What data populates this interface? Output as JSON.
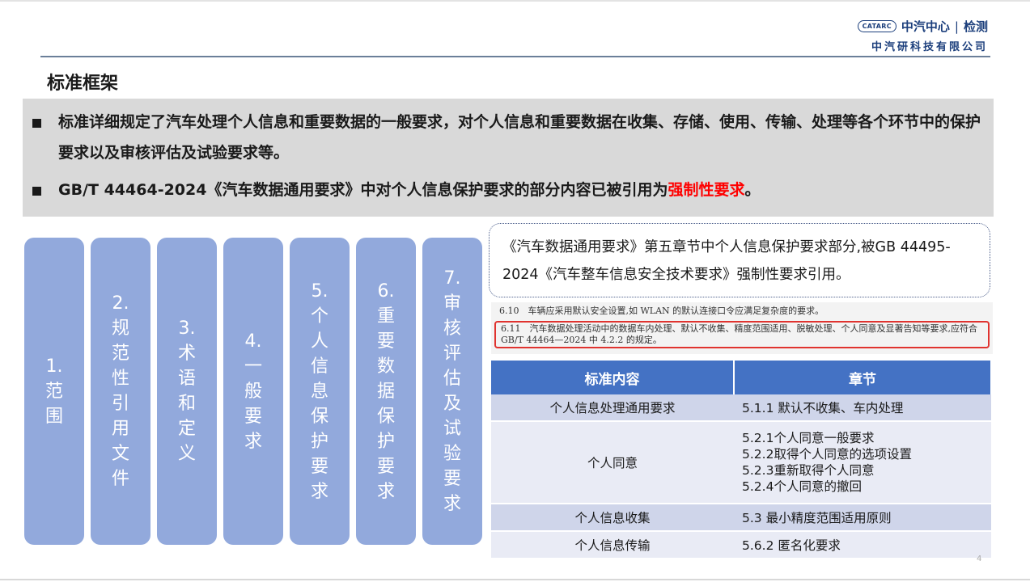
{
  "logo": {
    "mark": "CATARC",
    "brand": "中汽中心",
    "unit": "检测",
    "company": "中汽研科技有限公司"
  },
  "section_title": "标准框架",
  "intro": {
    "bullet1": "标准详细规定了汽车处理个人信息和重要数据的一般要求，对个人信息和重要数据在收集、存储、使用、传输、处理等各个环节中的保护要求以及审核评估及试验要求等。",
    "bullet2_prefix": "GB/T 44464-2024《汽车数据通用要求》中对个人信息保护要求的部分内容已被引用为",
    "bullet2_highlight": "强制性要求",
    "bullet2_suffix": "。"
  },
  "pillars": [
    {
      "label": "1.范围"
    },
    {
      "label": "2.规范性引用文件"
    },
    {
      "label": "3.术语和定义"
    },
    {
      "label": "4.一般要求"
    },
    {
      "label": "5.个人信息保护要求"
    },
    {
      "label": "6.重要数据保护要求"
    },
    {
      "label": "7.审核评估及试验要求"
    }
  ],
  "callout": "《汽车数据通用要求》第五章节中个人信息保护要求部分,被GB 44495-2024《汽车整车信息安全技术要求》强制性要求引用。",
  "excerpt": {
    "line1": "6.10　车辆应采用默认安全设置,如 WLAN 的默认连接口令应满足复杂度的要求。",
    "line2": "6.11　汽车数据处理活动中的数据车内处理、默认不收集、精度范围适用、脱敏处理、个人同意及显著告知等要求,应符合 GB/T 44464—2024 中 4.2.2 的规定。"
  },
  "table": {
    "headers": [
      "标准内容",
      "章节"
    ],
    "rows": [
      {
        "content": "个人信息处理通用要求",
        "chapter": [
          "5.1.1 默认不收集、车内处理"
        ]
      },
      {
        "content": "个人同意",
        "chapter": [
          "5.2.1个人同意一般要求",
          "5.2.2取得个人同意的选项设置",
          "5.2.3重新取得个人同意",
          "5.2.4个人同意的撤回"
        ]
      },
      {
        "content": "个人信息收集",
        "chapter": [
          "5.3 最小精度范围适用原则"
        ]
      },
      {
        "content": "个人信息传输",
        "chapter": [
          "5.6.2 匿名化要求"
        ]
      }
    ]
  },
  "page_number": "4"
}
